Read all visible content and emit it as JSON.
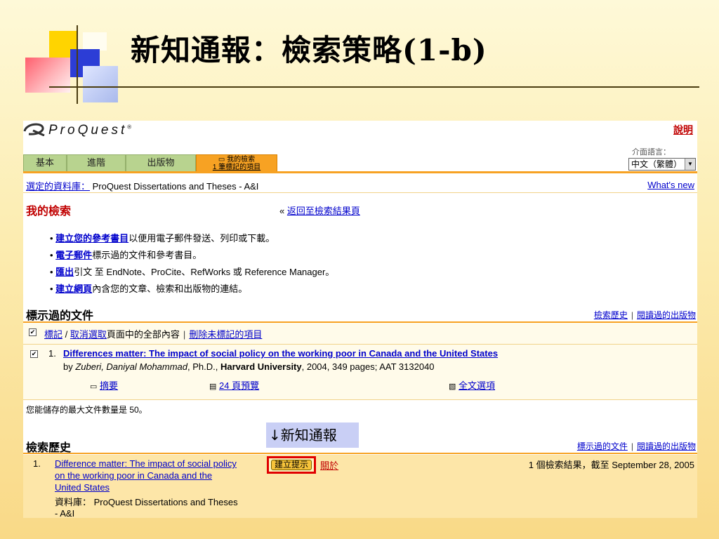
{
  "slide": {
    "title": "新知通報：檢索策略(1-b)"
  },
  "app": {
    "logo": "ProQuest",
    "help_link": "說明",
    "interface_lang_label": "介面語言：",
    "interface_lang_value": "中文（繁體）"
  },
  "tabs": [
    {
      "label": "基本"
    },
    {
      "label": "進階"
    },
    {
      "label": "出版物"
    },
    {
      "label_line1": "我的檢索",
      "label_line2": "1 筆標記的項目"
    }
  ],
  "database_bar": {
    "label": "選定的資料庫：",
    "value": "ProQuest Dissertations and Theses - A&I",
    "whats_new": "What's new"
  },
  "my_search": {
    "heading": "我的檢索",
    "back_prefix": "«",
    "back_link": "返回至檢索結果頁",
    "bullets": [
      {
        "link": "建立您的參考書目",
        "text": "以便用電子郵件發送、列印或下載。"
      },
      {
        "link": "電子郵件",
        "text": "標示過的文件和參考書目。"
      },
      {
        "link": "匯出",
        "text": "引文 至 EndNote、ProCite、RefWorks 或 Reference Manager。"
      },
      {
        "link": "建立網頁",
        "text": "內含您的文章、檢索和出版物的連結。"
      }
    ]
  },
  "marked_docs": {
    "heading": "標示過的文件",
    "nav_history": "檢索歷史",
    "nav_pubs": "閱讀過的出版物",
    "mark_link": "標記",
    "slash": "/",
    "unmark_link": "取消選取",
    "mark_rest": "頁面中的全部內容",
    "delete_unmarked": "刪除未標記的項目",
    "items": [
      {
        "num": "1.",
        "title": "Differences matter: The impact of social policy on the working poor in Canada and the United States",
        "by": "by ",
        "author": "Zuberi, Daniyal Mohammad",
        "degree": ", Ph.D., ",
        "school": "Harvard University",
        "rest": ", 2004, 349 pages; AAT 3132040",
        "abstract_link": "摘要",
        "preview_link": "24 頁預覽",
        "fulltext_link": "全文選項"
      }
    ],
    "max_note": "您能儲存的最大文件數量是 50。"
  },
  "callout": "↓新知通報",
  "search_history": {
    "heading": "檢索歷史",
    "nav_marked": "標示過的文件",
    "nav_pubs": "閱讀過的出版物",
    "items": [
      {
        "num": "1.",
        "query_line1": "Difference matter: The impact of social policy",
        "query_line2": "on the working poor in Canada and the",
        "query_line3": "United States",
        "create_alert": "建立提示",
        "about": "關於",
        "result_summary": "1 個檢索結果，截至 September 28, 2005",
        "db_label": "資料庫：",
        "db_value": "ProQuest Dissertations and Theses",
        "db_value_line2": "- A&I"
      }
    ]
  },
  "colors": {
    "tab_green": "#b8d38f",
    "tab_orange": "#f7a223",
    "link_blue": "#0000cc",
    "alert_red": "#e00000",
    "history_row": "#fde6a8",
    "callout_bg": "#c9cff5"
  }
}
